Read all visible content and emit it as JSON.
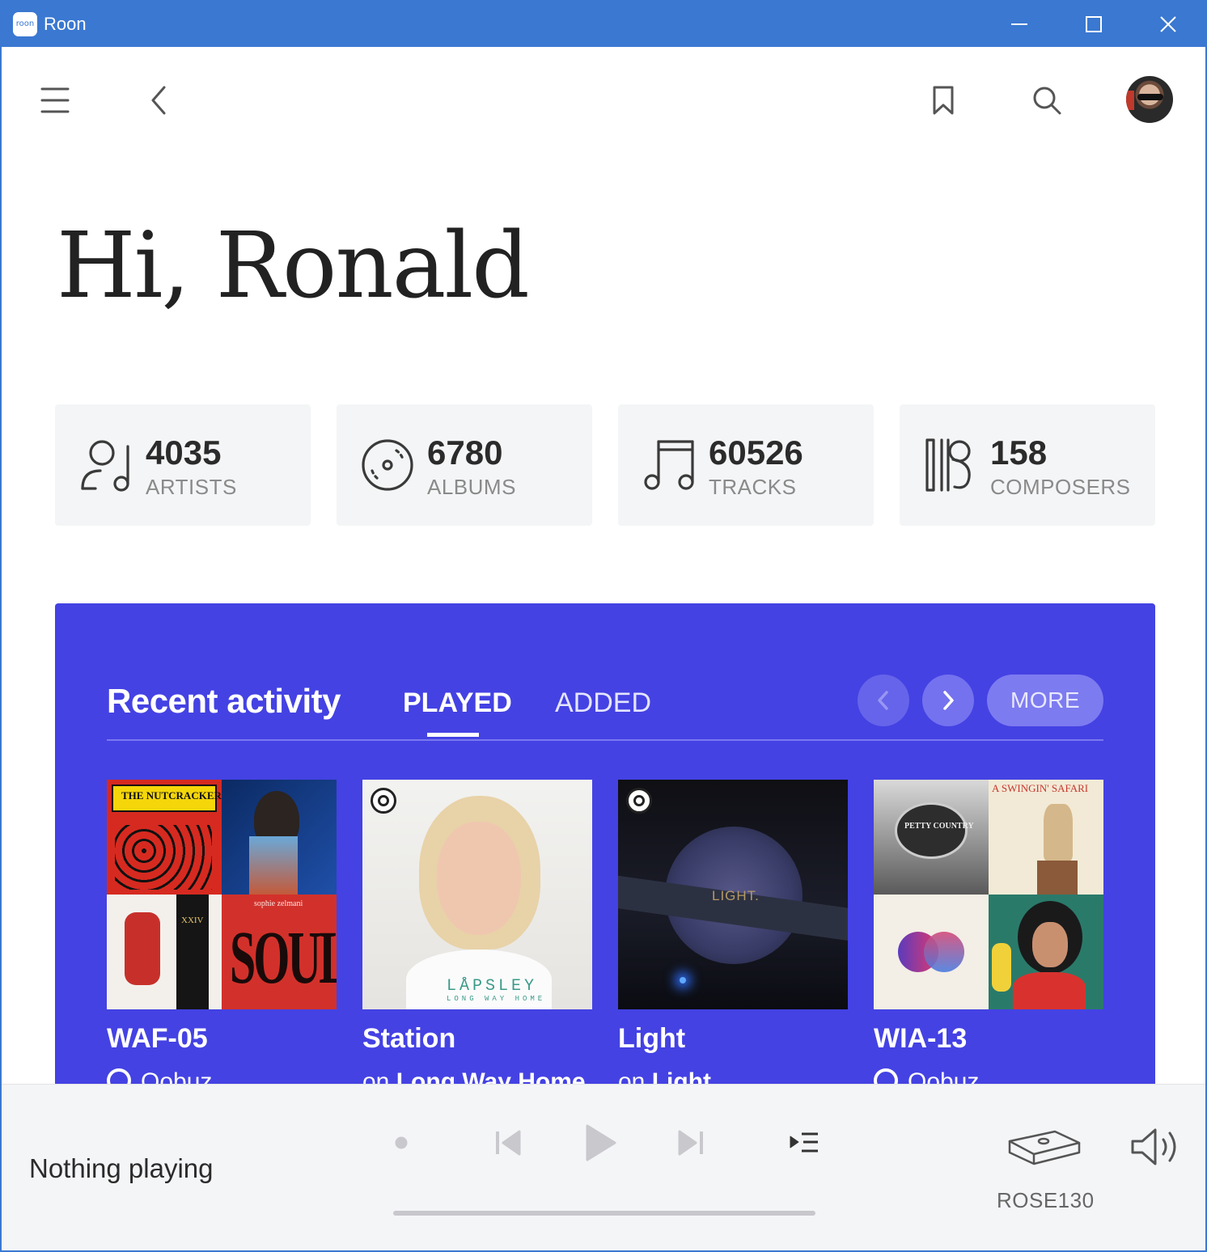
{
  "window": {
    "app_logo_text": "roon",
    "title": "Roon"
  },
  "nav": {
    "menu_icon": "hamburger-menu-icon",
    "back_icon": "chevron-left-icon",
    "bookmark_icon": "bookmark-icon",
    "search_icon": "search-icon",
    "avatar": "user-avatar"
  },
  "greeting": "Hi, Ronald",
  "stats": [
    {
      "icon": "artist-icon",
      "value": "4035",
      "label": "ARTISTS"
    },
    {
      "icon": "album-disc-icon",
      "value": "6780",
      "label": "ALBUMS"
    },
    {
      "icon": "music-note-icon",
      "value": "60526",
      "label": "TRACKS"
    },
    {
      "icon": "composer-icon",
      "value": "158",
      "label": "COMPOSERS"
    }
  ],
  "recent": {
    "title": "Recent activity",
    "tabs": [
      {
        "label": "PLAYED",
        "active": true
      },
      {
        "label": "ADDED",
        "active": false
      }
    ],
    "more_label": "MORE",
    "accent_color": "#4442e3",
    "items": [
      {
        "title": "WAF-05",
        "subtitle_prefix": "",
        "subtitle": "Qobuz",
        "subtitle_icon": "qobuz-icon",
        "art_texts": [
          "THE NUTCRACKER",
          "SOUL",
          "sophie zelmani",
          "XXIV"
        ]
      },
      {
        "title": "Station",
        "subtitle_prefix": "on",
        "subtitle": "Long Way Home",
        "art_texts": [
          "LÅPSLEY",
          "LONG WAY HOME"
        ]
      },
      {
        "title": "Light",
        "subtitle_prefix": "on",
        "subtitle": "Light",
        "art_texts": [
          "LIGHT."
        ]
      },
      {
        "title": "WIA-13",
        "subtitle_prefix": "",
        "subtitle": "Qobuz",
        "subtitle_icon": "qobuz-icon",
        "art_texts": [
          "A SWINGIN' SAFARI",
          "PETTY COUNTRY"
        ]
      }
    ]
  },
  "player": {
    "now_playing": "Nothing playing",
    "zone_name": "ROSE130",
    "progress": 0
  }
}
